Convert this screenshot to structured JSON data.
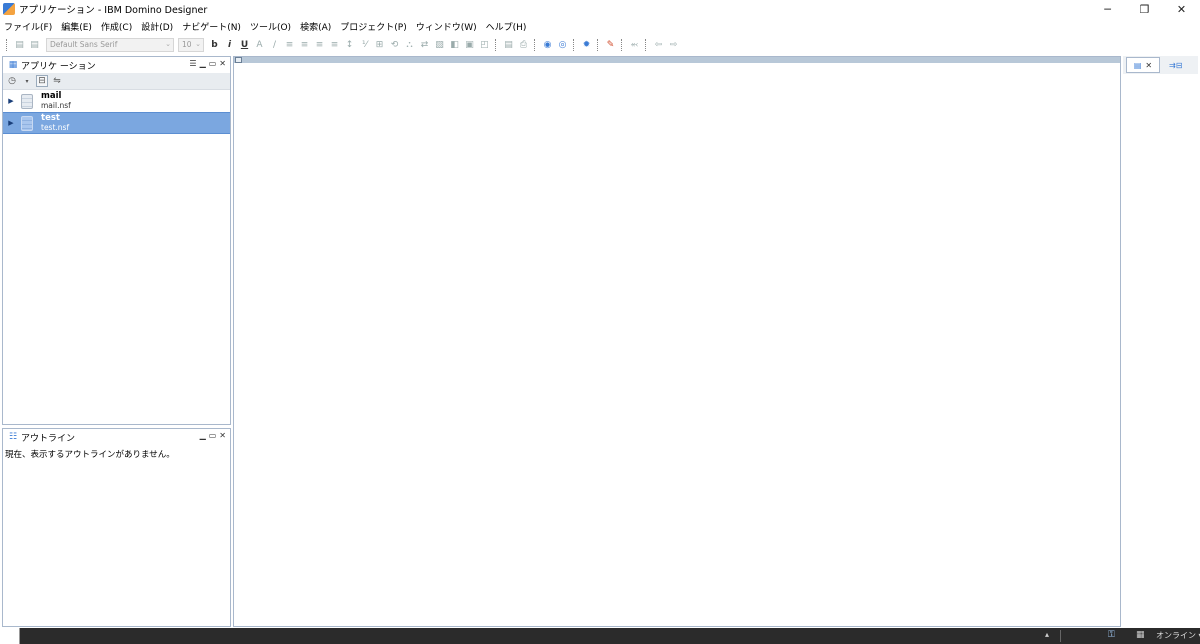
{
  "window": {
    "title": "アプリケーション - IBM Domino Designer",
    "minimize": "─",
    "restore": "❐",
    "close": "✕"
  },
  "menu": [
    "ファイル(F)",
    "編集(E)",
    "作成(C)",
    "設計(D)",
    "ナビゲート(N)",
    "ツール(O)",
    "検索(A)",
    "プロジェクト(P)",
    "ウィンドウ(W)",
    "ヘルプ(H)"
  ],
  "toolbar": {
    "font_family": "Default Sans Serif",
    "font_size": "10"
  },
  "applications_pane": {
    "title": "アプリケ ーション",
    "items": [
      {
        "name": "mail",
        "file": "mail.nsf",
        "selected": false
      },
      {
        "name": "test",
        "file": "test.nsf",
        "selected": true
      }
    ]
  },
  "outline_pane": {
    "title": "アウトライン",
    "message": "現在、表示するアウトラインがありません。"
  },
  "statusbar": {
    "status": "オンライン"
  },
  "colors": {
    "selection": "#7ba7e0",
    "pane_border": "#a9b8cc",
    "statusbar_bg": "#2b2b2b"
  }
}
